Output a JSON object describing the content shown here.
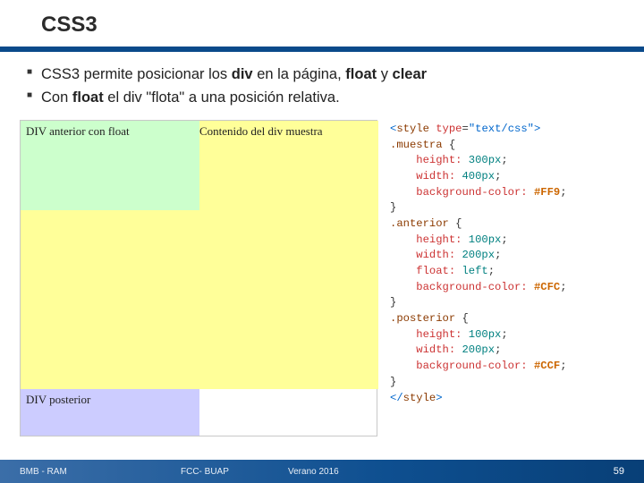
{
  "title": "CSS3",
  "bullets": [
    {
      "pre": "CSS3 permite posicionar los ",
      "b1": "div",
      "mid": " en la página, ",
      "b2": "float",
      "mid2": " y ",
      "b3": "clear",
      "post": ""
    },
    {
      "pre": "Con ",
      "b1": "float",
      "mid": " el div \"flota\" a una posición relativa.",
      "b2": "",
      "mid2": "",
      "b3": "",
      "post": ""
    }
  ],
  "demo": {
    "anterior_label": "DIV anterior con float",
    "muestra_label": "Contenido del div muestra",
    "posterior_label": "DIV posterior"
  },
  "code": {
    "style_open_1": "<",
    "style_tag": "style",
    "style_attr_name": "type",
    "style_attr_val": "\"text/css\"",
    "style_open_2": ">",
    "sel_muestra": ".muestra",
    "sel_anterior": ".anterior",
    "sel_posterior": ".posterior",
    "brace_open": " {",
    "brace_close": "}",
    "p_height": "height:",
    "p_width": "width:",
    "p_float": "float:",
    "p_bg": "background-color:",
    "v_300": "300px",
    "v_400": "400px",
    "v_100": "100px",
    "v_200": "200px",
    "v_left": "left",
    "hex_ff9": "#FF9",
    "hex_cfc": "#CFC",
    "hex_ccf": "#CCF",
    "semicolon": ";",
    "style_close": "</style>",
    "lt": "<",
    "slash": "/",
    "gt": ">"
  },
  "footer": {
    "left": "BMB - RAM",
    "mid1": "FCC- BUAP",
    "mid2": "Verano 2016",
    "right": "59"
  }
}
